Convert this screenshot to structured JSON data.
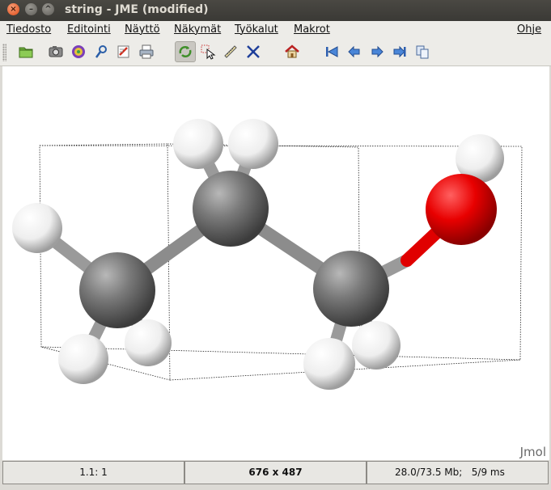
{
  "window": {
    "title": "string - JME (modified)",
    "controls": [
      "close-icon",
      "minimize-icon",
      "maximize-icon"
    ]
  },
  "menu": {
    "items": [
      "Tiedosto",
      "Editointi",
      "Näyttö",
      "Näkymät",
      "Työkalut",
      "Makrot"
    ],
    "help": "Ohje"
  },
  "toolbar": {
    "buttons": [
      {
        "name": "open-file",
        "icon": "folder-icon"
      },
      {
        "name": "capture-image",
        "icon": "camera-icon"
      },
      {
        "name": "record-animation",
        "icon": "film-icon"
      },
      {
        "name": "script",
        "icon": "script-icon"
      },
      {
        "name": "edit-script",
        "icon": "edit-icon"
      },
      {
        "name": "print",
        "icon": "printer-icon"
      },
      {
        "name": "rotate",
        "icon": "rotate-icon",
        "selected": true
      },
      {
        "name": "pick",
        "icon": "pointer-icon"
      },
      {
        "name": "measure",
        "icon": "ruler-icon"
      },
      {
        "name": "translate",
        "icon": "move-icon"
      },
      {
        "name": "home",
        "icon": "home-icon"
      },
      {
        "name": "first-frame",
        "icon": "first-frame-icon"
      },
      {
        "name": "previous-frame",
        "icon": "previous-frame-icon"
      },
      {
        "name": "next-frame",
        "icon": "next-frame-icon"
      },
      {
        "name": "last-frame",
        "icon": "last-frame-icon"
      },
      {
        "name": "all-frames",
        "icon": "copy-frames-icon"
      }
    ]
  },
  "viewer": {
    "watermark": "Jmol",
    "molecule": "1-propanol ball-and-stick model with unit cell box",
    "colors": {
      "carbon": "#6e6e6e",
      "hydrogen": "#f2f2f2",
      "oxygen": "#e00000"
    }
  },
  "status": {
    "frame": "1.1: 1",
    "size": "676 x 487",
    "memory": "28.0/73.5 Mb;",
    "timing": "5/9 ms"
  }
}
